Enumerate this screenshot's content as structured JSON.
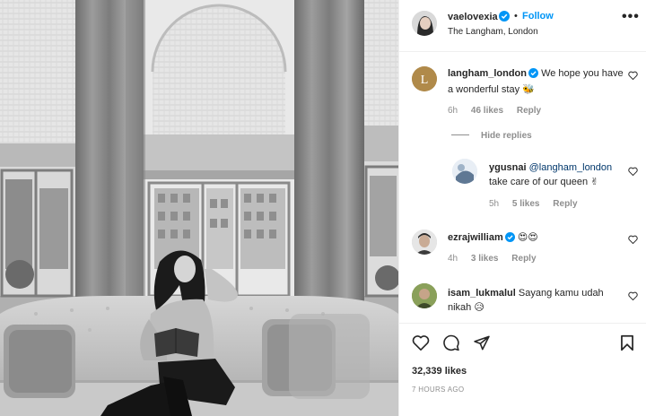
{
  "post": {
    "author": "vaelovexia",
    "follow_label": "Follow",
    "separator": "•",
    "location": "The Langham, London",
    "more_label": "•••"
  },
  "comments": [
    {
      "username": "langham_london",
      "verified": true,
      "text": "We hope you have a wonderful stay",
      "emoji": "🐝",
      "time": "6h",
      "likes": "46 likes",
      "reply_label": "Reply",
      "avatar_icon": "langham-logo-icon"
    },
    {
      "username": "ygusnai",
      "verified": false,
      "mention": "@langham_london",
      "text": "take care of our queen",
      "emoji": "✌",
      "time": "5h",
      "likes": "5 likes",
      "reply_label": "Reply",
      "is_reply": true
    },
    {
      "username": "ezrajwilliam",
      "verified": true,
      "text": "",
      "emoji": "😍😍",
      "time": "4h",
      "likes": "3 likes",
      "reply_label": "Reply"
    },
    {
      "username": "isam_lukmalul",
      "verified": false,
      "text": "Sayang kamu udah nikah",
      "emoji": "😥",
      "time": "",
      "likes": "",
      "reply_label": ""
    }
  ],
  "hide_replies_label": "Hide replies",
  "likes_total": "32,339 likes",
  "posted_ago": "7 HOURS AGO",
  "colors": {
    "link_blue": "#0095f6",
    "mention_blue": "#00376b",
    "muted": "#8e8e8e",
    "text": "#262626",
    "border": "#efefef",
    "langham_gold": "#b08a4a"
  }
}
